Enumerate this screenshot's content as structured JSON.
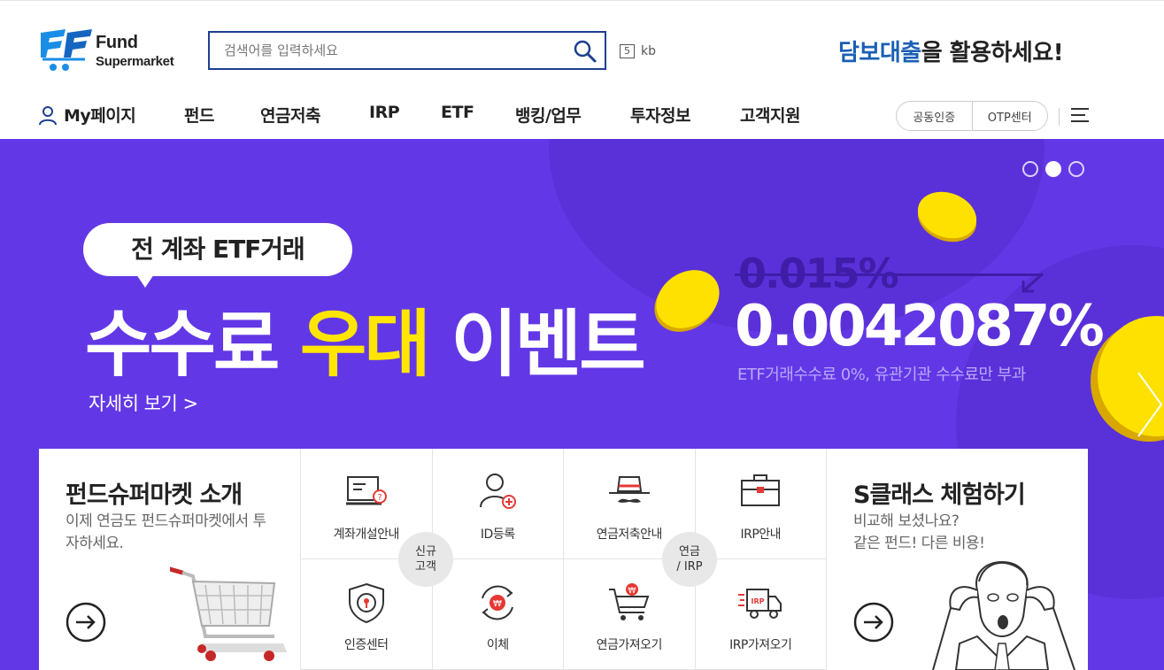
{
  "header": {
    "logo": {
      "line1": "Fund",
      "line2": "Supermarket"
    },
    "search": {
      "placeholder": "검색어를 입력하세요",
      "button_icon": "search-icon"
    },
    "kb": {
      "key": "5",
      "label": "kb"
    },
    "promo": {
      "highlight": "담보대출",
      "rest": "을 활용하세요!"
    }
  },
  "nav": {
    "mypage": "My페이지",
    "items": [
      "펀드",
      "연금저축",
      "IRP",
      "ETF",
      "뱅킹/업무",
      "투자정보",
      "고객지원"
    ],
    "auth": [
      "공동인증",
      "OTP센터"
    ]
  },
  "banner": {
    "bubble": "전 계좌 ETF거래",
    "headline_a": "수수료 ",
    "headline_b": "우대",
    "headline_c": " 이벤트",
    "detail": "자세히 보기 >",
    "old_rate": "0.015%",
    "new_rate": "0.0042087%",
    "note": "ETF거래수수료 0%, 유관기관 수수료만 부과",
    "slides": {
      "count": 3,
      "active_index": 1
    }
  },
  "intro": {
    "title": "펀드슈퍼마켓 소개",
    "desc": "이제 연금도 펀드슈퍼마켓에서 투자하세요."
  },
  "quick_menu": [
    {
      "label": "계좌개설안내",
      "icon": "account-doc-icon"
    },
    {
      "label": "ID등록",
      "icon": "user-add-icon"
    },
    {
      "label": "연금저축안내",
      "icon": "hat-mustache-icon"
    },
    {
      "label": "IRP안내",
      "icon": "briefcase-icon"
    },
    {
      "label": "인증센터",
      "icon": "shield-lock-icon"
    },
    {
      "label": "이체",
      "icon": "won-transfer-icon"
    },
    {
      "label": "연금가져오기",
      "icon": "cart-won-icon"
    },
    {
      "label": "IRP가져오기",
      "icon": "truck-irp-icon"
    }
  ],
  "badges": {
    "new_customer": "신규\n고객",
    "pension": "연금\n/ IRP"
  },
  "sclass": {
    "title": "S클래스 체험하기",
    "desc_line1": "비교해 보셨나요?",
    "desc_line2": "같은 펀드! 다른 비용!"
  },
  "colors": {
    "banner_bg": "#6238e6",
    "accent_yellow": "#ffe600",
    "brand_blue": "#1a5fb4",
    "search_border": "#1d3f8f"
  }
}
